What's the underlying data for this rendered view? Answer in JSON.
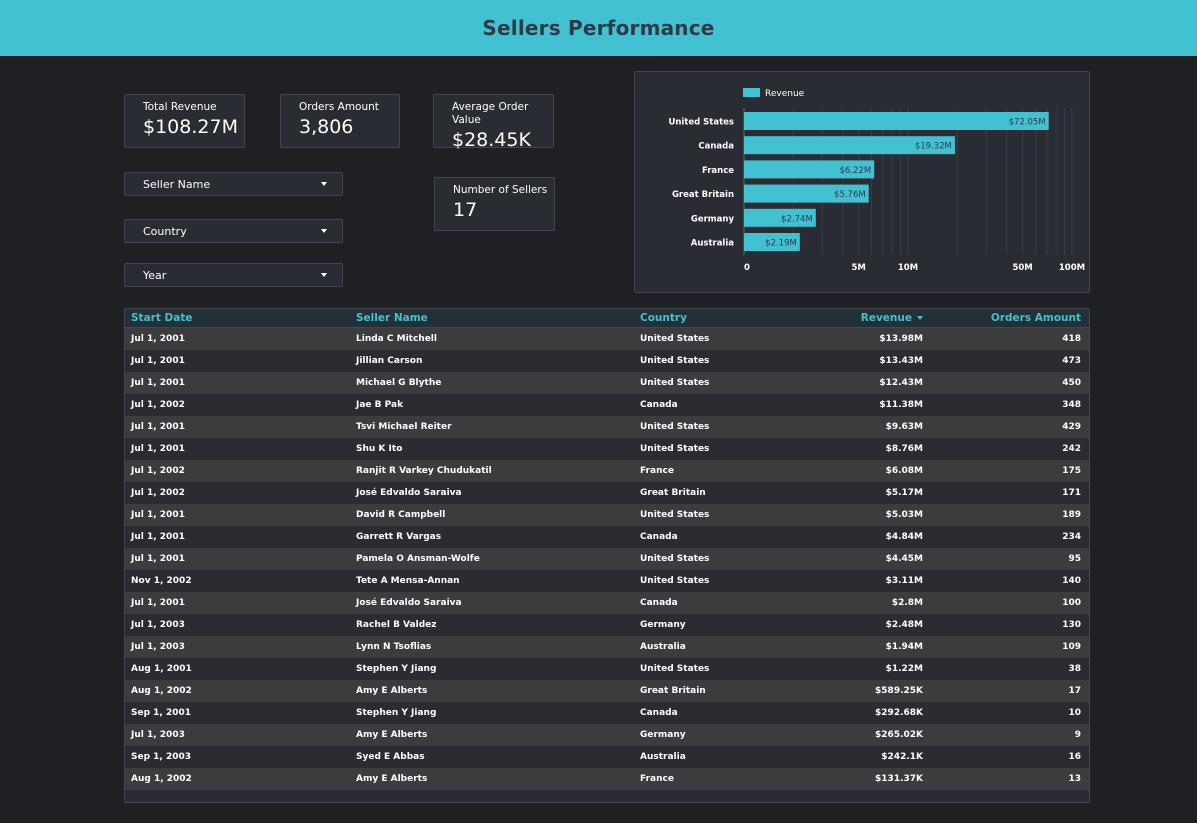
{
  "header": {
    "title": "Sellers Performance"
  },
  "kpis": {
    "total_revenue": {
      "label": "Total Revenue",
      "value": "$108.27M"
    },
    "orders_amount": {
      "label": "Orders Amount",
      "value": "3,806"
    },
    "avg_order_value": {
      "label": "Average Order Value",
      "value": "$28.45K"
    },
    "num_sellers": {
      "label": "Number of Sellers",
      "value": "17"
    }
  },
  "filters": {
    "seller_name": "Seller Name",
    "country": "Country",
    "year": "Year"
  },
  "colors": {
    "accent": "#42c1d3",
    "bar": "#42c1d3",
    "background": "#1f2024",
    "panel": "#2a2c33"
  },
  "icons": {
    "dropdown": "chevron-down-icon",
    "sort": "sort-desc-icon"
  },
  "chart_data": {
    "type": "bar",
    "orientation": "horizontal",
    "scale": "log",
    "legend": "top-left",
    "series": [
      {
        "name": "Revenue",
        "values": [
          72.05,
          19.32,
          6.22,
          5.76,
          2.74,
          2.19
        ]
      }
    ],
    "categories": [
      "United States",
      "Canada",
      "France",
      "Great Britain",
      "Germany",
      "Australia"
    ],
    "data_labels": [
      "$72.05M",
      "$19.32M",
      "$6.22M",
      "$5.76M",
      "$2.74M",
      "$2.19M"
    ],
    "x_ticks": [
      {
        "label": "0",
        "value": 1
      },
      {
        "label": "5M",
        "value": 5
      },
      {
        "label": "10M",
        "value": 10
      },
      {
        "label": "50M",
        "value": 50
      },
      {
        "label": "100M",
        "value": 100
      }
    ],
    "xlim": [
      1,
      100
    ],
    "grid": true
  },
  "table": {
    "columns": [
      "Start Date",
      "Seller Name",
      "Country",
      "Revenue",
      "Orders Amount"
    ],
    "rows": [
      [
        "Jul 1, 2001",
        "Linda C Mitchell",
        "United States",
        "$13.98M",
        "418"
      ],
      [
        "Jul 1, 2001",
        "Jillian Carson",
        "United States",
        "$13.43M",
        "473"
      ],
      [
        "Jul 1, 2001",
        "Michael G Blythe",
        "United States",
        "$12.43M",
        "450"
      ],
      [
        "Jul 1, 2002",
        "Jae B Pak",
        "Canada",
        "$11.38M",
        "348"
      ],
      [
        "Jul 1, 2001",
        "Tsvi Michael Reiter",
        "United States",
        "$9.63M",
        "429"
      ],
      [
        "Jul 1, 2001",
        "Shu K Ito",
        "United States",
        "$8.76M",
        "242"
      ],
      [
        "Jul 1, 2002",
        "Ranjit R Varkey Chudukatil",
        "France",
        "$6.08M",
        "175"
      ],
      [
        "Jul 1, 2002",
        "José Edvaldo Saraiva",
        "Great Britain",
        "$5.17M",
        "171"
      ],
      [
        "Jul 1, 2001",
        "David R Campbell",
        "United States",
        "$5.03M",
        "189"
      ],
      [
        "Jul 1, 2001",
        "Garrett R Vargas",
        "Canada",
        "$4.84M",
        "234"
      ],
      [
        "Jul 1, 2001",
        "Pamela O Ansman-Wolfe",
        "United States",
        "$4.45M",
        "95"
      ],
      [
        "Nov 1, 2002",
        "Tete A Mensa-Annan",
        "United States",
        "$3.11M",
        "140"
      ],
      [
        "Jul 1, 2001",
        "José Edvaldo Saraiva",
        "Canada",
        "$2.8M",
        "100"
      ],
      [
        "Jul 1, 2003",
        "Rachel B Valdez",
        "Germany",
        "$2.48M",
        "130"
      ],
      [
        "Jul 1, 2003",
        "Lynn N Tsoflias",
        "Australia",
        "$1.94M",
        "109"
      ],
      [
        "Aug 1, 2001",
        "Stephen Y Jiang",
        "United States",
        "$1.22M",
        "38"
      ],
      [
        "Aug 1, 2002",
        "Amy E Alberts",
        "Great Britain",
        "$589.25K",
        "17"
      ],
      [
        "Sep 1, 2001",
        "Stephen Y Jiang",
        "Canada",
        "$292.68K",
        "10"
      ],
      [
        "Jul 1, 2003",
        "Amy E Alberts",
        "Germany",
        "$265.02K",
        "9"
      ],
      [
        "Sep 1, 2003",
        "Syed E Abbas",
        "Australia",
        "$242.1K",
        "16"
      ],
      [
        "Aug 1, 2002",
        "Amy E Alberts",
        "France",
        "$131.37K",
        "13"
      ]
    ]
  }
}
